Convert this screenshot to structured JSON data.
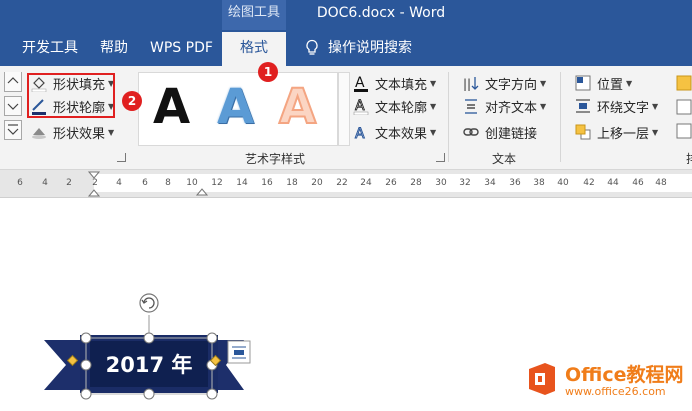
{
  "titlebar": {
    "context_tab": "绘图工具",
    "doc_title": "DOC6.docx  -  Word"
  },
  "tabs": {
    "developer": "开发工具",
    "help": "帮助",
    "wps_pdf": "WPS PDF",
    "format": "格式",
    "search": "操作说明搜索"
  },
  "shape_styles": {
    "fill": "形状填充",
    "outline": "形状轮廓",
    "effects": "形状效果"
  },
  "wordart": {
    "group_label": "艺术字样式",
    "text_fill": "文本填充",
    "text_outline": "文本轮廓",
    "text_effects": "文本效果",
    "gallery": [
      "A",
      "A",
      "A"
    ]
  },
  "text_group": {
    "label": "文本",
    "direction": "文字方向",
    "align": "对齐文本",
    "link": "创建链接"
  },
  "arrange": {
    "position": "位置",
    "wrap": "环绕文字",
    "bring_forward": "上移一层",
    "label_partial": "排"
  },
  "callouts": {
    "one": "1",
    "two": "2"
  },
  "ruler": {
    "ticks": [
      "6",
      "4",
      "2",
      "2",
      "4",
      "6",
      "8",
      "10",
      "12",
      "14",
      "16",
      "18",
      "20",
      "22",
      "24",
      "26",
      "28",
      "30",
      "32",
      "34",
      "36",
      "38",
      "40",
      "42",
      "44",
      "46",
      "48"
    ]
  },
  "document": {
    "banner_text": "2017 年"
  },
  "watermark": {
    "brand": "Office教程网",
    "url": "www.office26.com"
  },
  "colors": {
    "word_blue": "#2b579a",
    "highlight_red": "#e02020",
    "banner_navy": "#1d2f6b",
    "banner_inner": "#0f2050",
    "watermark_orange": "#f07d1a"
  }
}
